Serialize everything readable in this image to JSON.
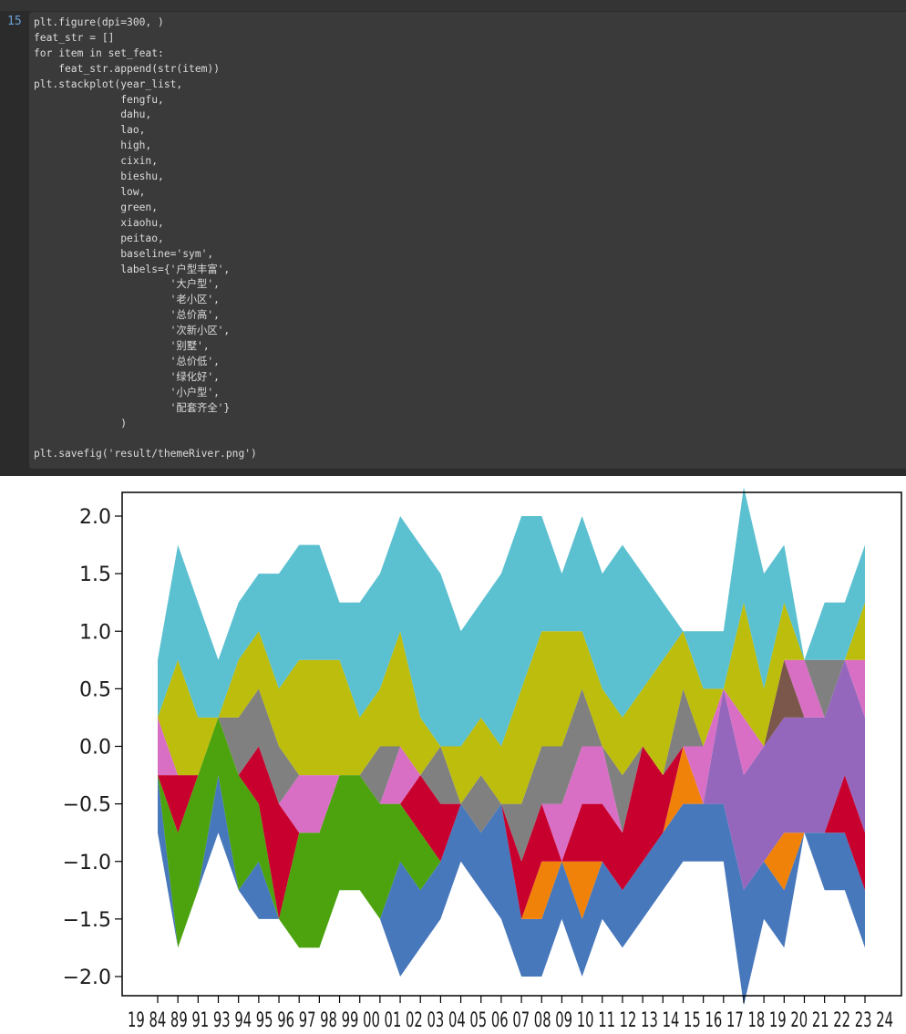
{
  "cell": {
    "line_number": "15",
    "code_lines": [
      "plt.figure(dpi=300, )",
      "feat_str = []",
      "for item in set_feat:",
      "    feat_str.append(str(item))",
      "plt.stackplot(year_list,",
      "              fengfu,",
      "              dahu,",
      "              lao,",
      "              high,",
      "              cixin,",
      "              bieshu,",
      "              low,",
      "              green,",
      "              xiaohu,",
      "              peitao,",
      "              baseline='sym',",
      "              labels={'户型丰富',",
      "                      '大户型',",
      "                      '老小区',",
      "                      '总价高',",
      "                      '次新小区',",
      "                      '别墅',",
      "                      '总价低',",
      "                      '绿化好',",
      "                      '小户型',",
      "                      '配套齐全'}",
      "              )",
      "",
      "plt.savefig('result/themeRiver.png')"
    ]
  },
  "chart_data": {
    "type": "area",
    "baseline": "sym",
    "ylim": [
      -2.0,
      2.0
    ],
    "yticks": [
      "2.0",
      "1.5",
      "1.0",
      "0.5",
      "0.0",
      "−0.5",
      "−1.0",
      "−1.5",
      "−2.0"
    ],
    "xtick_count": 36,
    "xtick_label_text_overlapping": "19 84 89 91 93 94 95 96 97 98 99 00 01 02 03 04 05 06 07 08 09 10 11 12 13 14 15 16 17 18 19 20 21 22 23 24",
    "xtick_first_label": "19",
    "xtick_last_label": "24",
    "series": [
      {
        "name": "fengfu",
        "color": "#4878bc"
      },
      {
        "name": "dahu",
        "color": "#f0820a"
      },
      {
        "name": "lao",
        "color": "#4ca30e"
      },
      {
        "name": "high",
        "color": "#c8002e"
      },
      {
        "name": "cixin",
        "color": "#9467bd"
      },
      {
        "name": "bieshu",
        "color": "#7b564b"
      },
      {
        "name": "low",
        "color": "#d86fc4"
      },
      {
        "name": "green",
        "color": "#808080"
      },
      {
        "name": "xiaohu",
        "color": "#bcbd0c"
      },
      {
        "name": "peitao",
        "color": "#5bc0d0"
      }
    ],
    "values": [
      [
        0.5,
        0.0,
        0.0,
        0.0,
        0.0,
        0.0,
        0.5,
        0.0,
        0.0,
        0.5
      ],
      [
        0,
        0,
        1,
        0.5,
        0,
        0,
        0,
        0,
        1,
        1
      ],
      [
        0,
        0,
        1,
        0,
        0,
        0,
        0,
        0,
        0.5,
        1
      ],
      [
        0.5,
        0,
        0.5,
        0,
        0,
        0,
        0,
        0,
        0,
        0.5
      ],
      [
        0,
        0,
        1,
        0,
        0,
        0,
        0,
        0.5,
        0.5,
        0.5
      ],
      [
        0.5,
        0,
        0.5,
        0.5,
        0,
        0,
        0,
        0.5,
        0.5,
        0.5
      ],
      [
        0,
        0,
        0,
        1,
        0,
        0,
        0,
        0.5,
        0.5,
        1
      ],
      [
        0,
        0,
        1,
        0,
        0,
        0,
        0.5,
        0,
        1,
        1
      ],
      [
        0,
        0,
        1,
        0,
        0,
        0,
        0.5,
        0,
        1,
        1
      ],
      [
        0,
        0,
        1,
        0,
        0,
        0,
        0,
        0,
        1,
        0.5
      ],
      [
        0,
        0,
        1,
        0,
        0,
        0,
        0,
        0,
        0.5,
        1
      ],
      [
        0,
        0,
        1,
        0,
        0,
        0,
        0,
        0.5,
        0.5,
        1
      ],
      [
        1,
        0,
        0.5,
        0,
        0,
        0,
        0.5,
        0,
        1,
        1
      ],
      [
        0.5,
        0,
        0.5,
        0.5,
        0,
        0,
        0,
        0,
        0.5,
        1.5
      ],
      [
        0.5,
        0,
        0,
        0.5,
        0,
        0,
        0,
        0.5,
        0,
        1.5
      ],
      [
        0.5,
        0,
        0,
        0,
        0,
        0,
        0,
        0,
        0.5,
        1
      ],
      [
        0.5,
        0,
        0,
        0,
        0,
        0,
        0,
        0.5,
        0.5,
        1
      ],
      [
        1,
        0,
        0,
        0,
        0,
        0,
        0,
        0,
        0.5,
        1.5
      ],
      [
        0.5,
        0,
        0,
        0.5,
        0,
        0,
        0,
        0.5,
        1,
        1.5
      ],
      [
        0.5,
        0.5,
        0,
        0.5,
        0,
        0,
        0,
        0.5,
        1,
        1
      ],
      [
        0.5,
        0,
        0,
        0,
        0,
        0,
        0.5,
        0.5,
        1,
        0.5
      ],
      [
        0.5,
        0.5,
        0,
        0.5,
        0,
        0,
        0.5,
        0.5,
        0.5,
        1
      ],
      [
        0.5,
        0,
        0,
        0.5,
        0,
        0,
        0.5,
        0,
        0.5,
        1
      ],
      [
        0.5,
        0,
        0,
        0.5,
        0,
        0,
        0,
        0.5,
        0.5,
        1.5
      ],
      [
        0.5,
        0,
        0,
        1,
        0,
        0,
        0,
        0,
        0.5,
        1
      ],
      [
        0.5,
        0,
        0,
        0.5,
        0,
        0,
        0,
        0,
        1,
        0.5
      ],
      [
        0.5,
        0.5,
        0,
        0,
        0,
        0,
        0,
        0.5,
        0.5,
        0
      ],
      [
        0.5,
        0,
        0,
        0,
        0,
        0,
        0.5,
        0,
        0.5,
        0.5
      ],
      [
        0.5,
        0,
        0,
        0,
        1,
        0,
        0,
        0,
        0,
        0.5
      ],
      [
        1,
        0,
        0,
        0,
        1,
        0,
        0.5,
        0,
        1,
        1
      ],
      [
        0.5,
        0,
        0,
        0,
        1,
        0,
        0,
        0,
        0.5,
        1
      ],
      [
        0.5,
        0.5,
        0,
        0,
        1,
        0.5,
        0,
        0,
        0.5,
        0.5
      ],
      [
        0,
        0,
        0,
        0,
        1,
        0,
        0.5,
        0,
        0,
        0
      ],
      [
        0.5,
        0,
        0,
        0,
        1,
        0,
        0,
        0.5,
        0,
        0.5
      ],
      [
        0.5,
        0,
        0,
        0.5,
        1,
        0,
        0,
        0,
        0,
        0.5
      ],
      [
        0.5,
        0,
        0,
        0.5,
        1,
        0,
        0.5,
        0,
        0.5,
        0.5
      ]
    ]
  }
}
